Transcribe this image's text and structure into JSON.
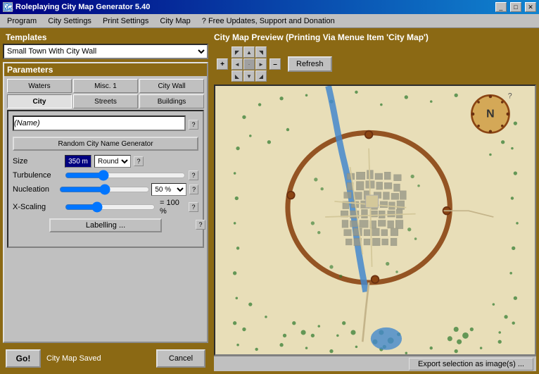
{
  "window": {
    "title": "Roleplaying City Map Generator 5.40",
    "title_icon": "map-icon"
  },
  "titlebar_buttons": {
    "minimize": "_",
    "maximize": "□",
    "close": "✕"
  },
  "menu": {
    "items": [
      "Program",
      "City Settings",
      "Print Settings",
      "City Map",
      "? Free Updates, Support and Donation"
    ]
  },
  "left_panel": {
    "templates_label": "Templates",
    "template_value": "Small Town With City Wall",
    "parameters_label": "Parameters",
    "tabs_row1": [
      "Waters",
      "Misc. 1",
      "City Wall"
    ],
    "tabs_row2": [
      "City",
      "Streets",
      "Buildings"
    ],
    "active_tab": "City",
    "name_field": "(Name)",
    "name_placeholder": "(Name)",
    "random_btn": "Random City Name Generator",
    "size_label": "Size",
    "size_value": "350 m",
    "round_label": "Round",
    "turbulence_label": "Turbulence",
    "nucleation_label": "Nucleation",
    "nucleation_value": "50 %",
    "xscaling_label": "X-Scaling",
    "xscaling_value": "= 100 %",
    "labelling_btn": "Labelling ...",
    "help_symbol": "?"
  },
  "bottom": {
    "go_label": "Go!",
    "status": "City Map Saved",
    "cancel_label": "Cancel"
  },
  "right_panel": {
    "map_title": "City Map Preview (Printing Via Menue Item 'City Map')",
    "refresh_label": "Refresh",
    "compass_label": "N",
    "export_label": "Export selection as image(s) ..."
  },
  "nav_arrows": {
    "up_left": "◄▲",
    "up": "▲",
    "up_right": "▲►",
    "left": "◄",
    "center": "·",
    "right": "►",
    "down_left": "◄▼",
    "down": "▼",
    "down_right": "▼►"
  },
  "zoom": {
    "plus": "+",
    "minus": "–"
  }
}
